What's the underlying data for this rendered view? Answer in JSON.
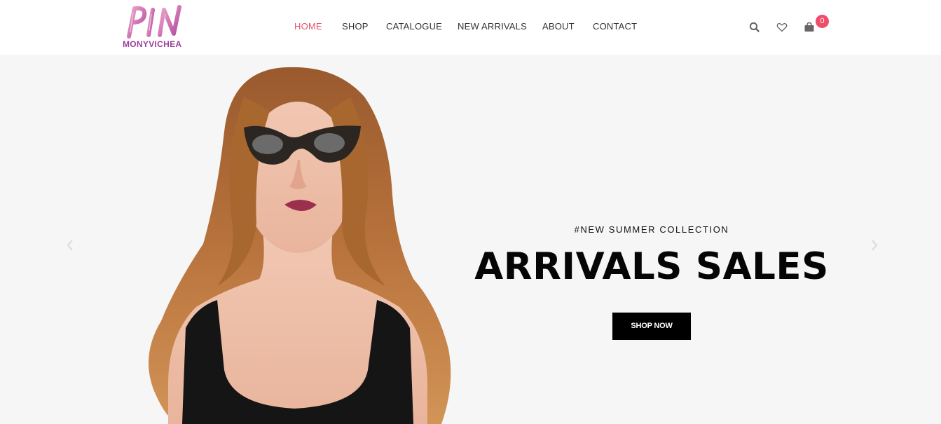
{
  "brand": {
    "logo_text": "PIN",
    "subtitle": "MONYVICHEA",
    "logo_color": "#9b3f9e",
    "logo_accent": "#e8a0c4"
  },
  "nav": {
    "items": [
      {
        "label": "HOME",
        "active": true
      },
      {
        "label": "SHOP"
      },
      {
        "label": "CATALOGUE"
      },
      {
        "label": "NEW ARRIVALS"
      },
      {
        "label": "ABOUT"
      },
      {
        "label": "CONTACT"
      }
    ],
    "active_color": "#e0566b"
  },
  "header_icons": {
    "search": "search-icon",
    "wishlist": "heart-icon",
    "cart": "shopping-bag-icon"
  },
  "cart": {
    "count": "0",
    "badge_color": "#ef4d6a"
  },
  "hero": {
    "tagline": "#NEW SUMMER COLLECTION",
    "headline": "ARRIVALS SALES",
    "cta_label": "SHOP NOW",
    "prev_icon": "chevron-left-icon",
    "next_icon": "chevron-right-icon",
    "background": "#f6f6f6"
  }
}
